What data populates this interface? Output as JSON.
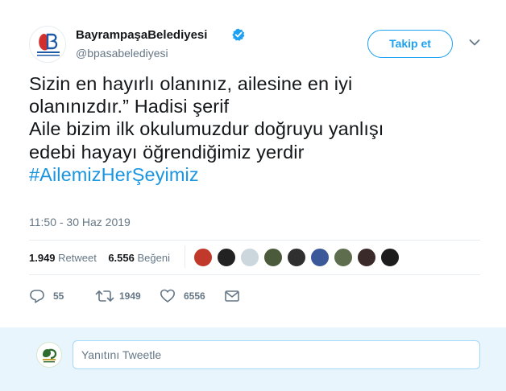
{
  "account": {
    "display_name": "BayrampaşaBelediyesi",
    "handle": "@bpasabelediyesi",
    "verified": true,
    "avatar_text": "BAYRAMPAŞA BELEDİYESİ"
  },
  "header": {
    "follow_label": "Takip et",
    "menu_icon": "chevron-down-icon"
  },
  "tweet": {
    "lines": [
      "Sizin en hayırlı olanınız, ailesine en iyi",
      "olanınızdır.” Hadisi şerif",
      "Aile bizim ilk okulumuzdur doğruyu yanlışı",
      "edebi hayayı öğrendiğimiz yerdir"
    ],
    "hashtag": "#AilemizHerŞeyimiz",
    "timestamp": "11:50 - 30 Haz 2019"
  },
  "stats": {
    "retweet_count": "1.949",
    "retweet_label": "Retweet",
    "like_count": "6.556",
    "like_label": "Beğeni"
  },
  "likers": [
    "#c0392b",
    "#222222",
    "#ccd6dd",
    "#4a5a3a",
    "#2f2f2f",
    "#3b5998",
    "#5d6d4e",
    "#3a2a2a",
    "#1c1c1c"
  ],
  "actions": {
    "reply_count": "55",
    "retweet_count": "1949",
    "like_count": "6556"
  },
  "reply": {
    "placeholder": "Yanıtını Tweetle"
  },
  "colors": {
    "accent": "#1da1f2",
    "hashtag": "#1b95e0",
    "muted": "#657786",
    "reply_bg": "#e8f5fd"
  }
}
